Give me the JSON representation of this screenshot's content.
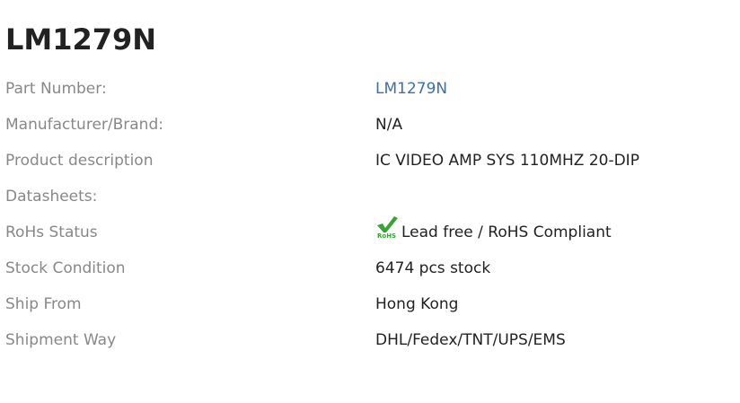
{
  "product": {
    "title": "LM1279N"
  },
  "specs": [
    {
      "label": "Part Number:",
      "value": "LM1279N"
    },
    {
      "label": "Manufacturer/Brand:",
      "value": "N/A"
    },
    {
      "label": "Product description",
      "value": "IC VIDEO AMP SYS 110MHZ 20-DIP"
    },
    {
      "label": "Datasheets:",
      "value": ""
    },
    {
      "label": "RoHs Status",
      "value": "Lead free / RoHS Compliant",
      "icon": "rohs-check-icon",
      "icon_text": "RoHS"
    },
    {
      "label": "Stock Condition",
      "value": "6474 pcs stock"
    },
    {
      "label": "Ship From",
      "value": "Hong Kong"
    },
    {
      "label": "Shipment Way",
      "value": "DHL/Fedex/TNT/UPS/EMS"
    }
  ],
  "colors": {
    "label": "#888888",
    "value": "#222222",
    "link": "#3f6fa8",
    "rohs_green": "#3aa335"
  }
}
